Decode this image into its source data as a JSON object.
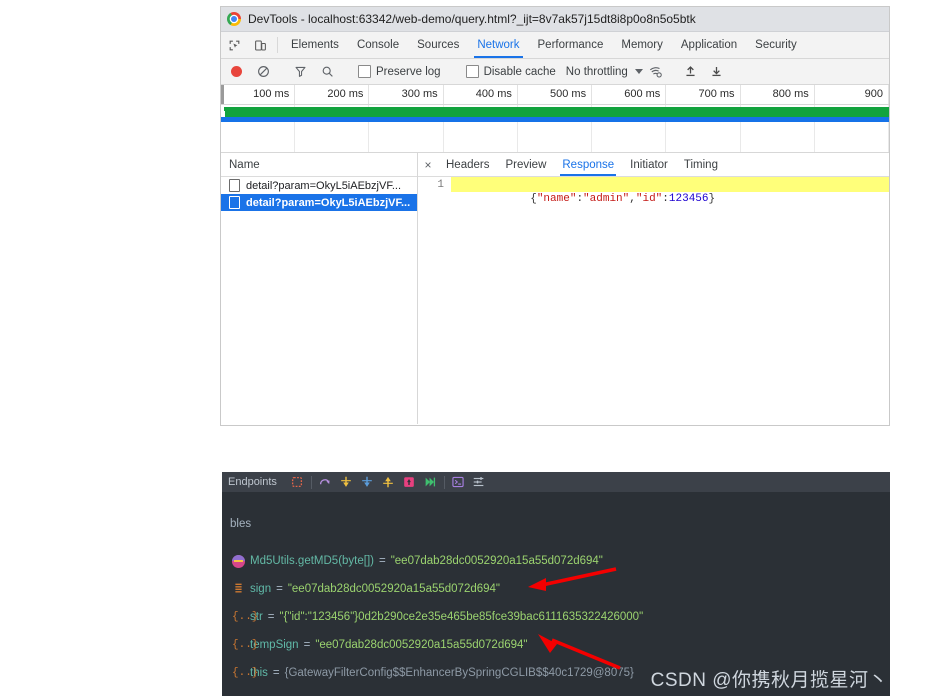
{
  "devtools": {
    "title": "DevTools - localhost:63342/web-demo/query.html?_ijt=8v7ak57j15dt8i8p0o8n5o5btk",
    "icons": {
      "chrome": "chrome-logo-icon",
      "inspect": "inspect-element-icon",
      "device": "device-toolbar-icon",
      "record": "record-icon",
      "clear": "clear-icon",
      "filter": "filter-icon",
      "search": "search-icon",
      "wifi": "network-conditions-icon",
      "import": "import-har-icon",
      "export": "export-har-icon",
      "close": "close-icon"
    },
    "tabs": [
      {
        "label": "Elements",
        "active": false
      },
      {
        "label": "Console",
        "active": false
      },
      {
        "label": "Sources",
        "active": false
      },
      {
        "label": "Network",
        "active": true
      },
      {
        "label": "Performance",
        "active": false
      },
      {
        "label": "Memory",
        "active": false
      },
      {
        "label": "Application",
        "active": false
      },
      {
        "label": "Security",
        "active": false
      }
    ],
    "toolbar": {
      "preserve_log": "Preserve log",
      "disable_cache": "Disable cache",
      "throttling": "No throttling"
    },
    "timeline": {
      "ticks": [
        "100 ms",
        "200 ms",
        "300 ms",
        "400 ms",
        "500 ms",
        "600 ms",
        "700 ms",
        "800 ms",
        "900"
      ],
      "band_green": "#12a33d",
      "band_blue": "#1572e8"
    },
    "requests": {
      "column_header": "Name",
      "rows": [
        {
          "name": "detail?param=OkyL5iAEbzjVF...",
          "selected": false
        },
        {
          "name": "detail?param=OkyL5iAEbzjVF...",
          "selected": true
        }
      ]
    },
    "detail": {
      "tabs": [
        {
          "label": "Headers",
          "active": false
        },
        {
          "label": "Preview",
          "active": false
        },
        {
          "label": "Response",
          "active": true
        },
        {
          "label": "Initiator",
          "active": false
        },
        {
          "label": "Timing",
          "active": false
        }
      ],
      "close_label": "×",
      "response": {
        "line_number": "1",
        "text": "{\"name\":\"admin\",\"id\":123456}",
        "highlight_color": "#ffff7a",
        "parts": [
          {
            "t": "{",
            "cls": "jpunc"
          },
          {
            "t": "\"name\"",
            "cls": "jkey"
          },
          {
            "t": ":",
            "cls": "jpunc"
          },
          {
            "t": "\"admin\"",
            "cls": "jkey"
          },
          {
            "t": ",",
            "cls": "jpunc"
          },
          {
            "t": "\"id\"",
            "cls": "jkey"
          },
          {
            "t": ":",
            "cls": "jpunc"
          },
          {
            "t": "123456",
            "cls": "jnum"
          },
          {
            "t": "}",
            "cls": "jpunc"
          }
        ]
      }
    }
  },
  "debugger": {
    "toolbar_label": "Endpoints",
    "toolbar_icons": [
      "mute-breakpoints-icon",
      "step-over-icon",
      "step-into-icon",
      "force-step-into-icon",
      "step-out-icon",
      "run-to-cursor-icon",
      "resume-program-icon",
      "evaluate-expression-icon",
      "settings-icon"
    ],
    "panel_title": "bles",
    "variables": [
      {
        "gutter": "method-result-icon",
        "gutter_kind": "method",
        "name": "Md5Utils.getMD5(byte[])",
        "eq": "=",
        "value": "\"ee07dab28dc0052920a15a55d072d694\"",
        "value_kind": "string"
      },
      {
        "gutter": "field-icon",
        "gutter_kind": "field",
        "name": "sign",
        "eq": "=",
        "value": "\"ee07dab28dc0052920a15a55d072d694\"",
        "value_kind": "string"
      },
      {
        "gutter": "object-icon",
        "gutter_kind": "object",
        "name": "str",
        "eq": "=",
        "value": "\"{\"id\":\"123456\"}0d2b290ce2e35e465be85fce39bac6111635322426000\"",
        "value_kind": "string"
      },
      {
        "gutter": "object-icon",
        "gutter_kind": "object",
        "name": "tempSign",
        "eq": "=",
        "value": "\"ee07dab28dc0052920a15a55d072d694\"",
        "value_kind": "string"
      },
      {
        "gutter": "object-icon",
        "gutter_kind": "object",
        "name": "this",
        "eq": "=",
        "value": "{GatewayFilterConfig$$EnhancerBySpringCGLIB$$40c1729@8075}",
        "value_kind": "object"
      }
    ],
    "annotations": {
      "arrow_color": "#f40000",
      "arrow_1": "points-to-sign-value",
      "arrow_2": "points-to-tempSign-value"
    }
  },
  "watermark": {
    "text": "CSDN @你携秋月揽星河丶"
  }
}
